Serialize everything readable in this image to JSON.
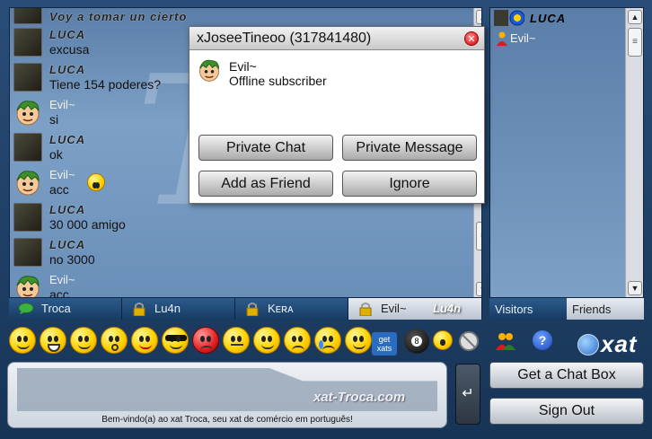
{
  "chat": {
    "background_letter": "T",
    "messages": [
      {
        "user": "LUCA",
        "text": "Voy a tomar un cierto",
        "kind": "luca"
      },
      {
        "user": "LUCA",
        "text": "excusa",
        "kind": "luca"
      },
      {
        "user": "LUCA",
        "text": "Tiene 154 poderes?",
        "kind": "luca"
      },
      {
        "user": "Evil~",
        "text": "si",
        "kind": "evil"
      },
      {
        "user": "LUCA",
        "text": "ok",
        "kind": "luca"
      },
      {
        "user": "Evil~",
        "text": "acc",
        "kind": "evil"
      },
      {
        "user": "LUCA",
        "text": "30 000 amigo",
        "kind": "luca"
      },
      {
        "user": "LUCA",
        "text": "no 3000",
        "kind": "luca"
      },
      {
        "user": "Evil~",
        "text": "acc",
        "kind": "evil"
      }
    ]
  },
  "tabs": [
    {
      "label": "Troca",
      "icon": "chat-bubble-icon",
      "active": false
    },
    {
      "label": "Lu4n",
      "icon": "lock-icon",
      "active": false
    },
    {
      "label": "Kᴇʀᴀ",
      "icon": "lock-icon",
      "active": false
    },
    {
      "label": "Evil~",
      "icon": "lock-icon",
      "active": true
    }
  ],
  "tab_logo": "Lu4n",
  "visitors": {
    "list": [
      {
        "name": "LUCA",
        "icon": "moderator-icon"
      },
      {
        "name": "Evil~",
        "icon": "user-icon"
      }
    ],
    "tab_visitors": "Visitors",
    "tab_friends": "Friends"
  },
  "toolbar": {
    "get_xats_line1": "get",
    "get_xats_line2": "xats",
    "ball_label": "8"
  },
  "brand": {
    "logo_text": "xat"
  },
  "input": {
    "watermark": "xat-Troca.com",
    "welcome": "Bem-vindo(a) ao xat Troca, seu xat de comércio em português!",
    "send_label": "↵"
  },
  "buttons": {
    "get_chat_box": "Get a Chat Box",
    "sign_out": "Sign Out"
  },
  "dialog": {
    "title": "xJoseeTineoo (317841480)",
    "user_name": "Evil~",
    "user_status": "Offline subscriber",
    "private_chat": "Private Chat",
    "private_message": "Private Message",
    "add_friend": "Add as Friend",
    "ignore": "Ignore",
    "close_glyph": "✕"
  },
  "colors": {
    "panel_blue": "#6a8fb8",
    "dialog_close_red": "#d40000",
    "help_blue": "#1c47b8"
  }
}
